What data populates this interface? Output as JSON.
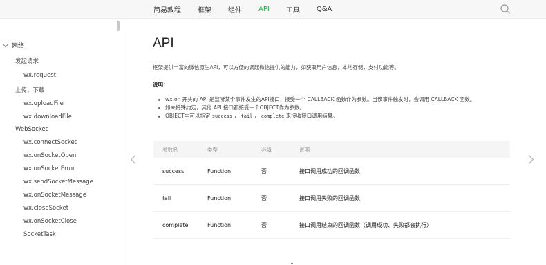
{
  "nav": {
    "items": [
      {
        "label": "简易教程",
        "active": false
      },
      {
        "label": "框架",
        "active": false
      },
      {
        "label": "组件",
        "active": false
      },
      {
        "label": "API",
        "active": true
      },
      {
        "label": "工具",
        "active": false
      },
      {
        "label": "Q&A",
        "active": false
      }
    ],
    "accent_color": "#16b23b"
  },
  "sidebar": {
    "group": "网络",
    "sections": [
      {
        "title": "发起请求",
        "items": [
          "wx.request"
        ]
      },
      {
        "title": "上传、下载",
        "items": [
          "wx.uploadFile",
          "wx.downloadFile"
        ]
      },
      {
        "title": "WebSocket",
        "items": [
          "wx.connectSocket",
          "wx.onSocketOpen",
          "wx.onSocketError",
          "wx.sendSocketMessage",
          "wx.onSocketMessage",
          "wx.closeSocket",
          "wx.onSocketClose",
          "SocketTask"
        ]
      }
    ]
  },
  "content": {
    "title": "API",
    "intro": "框架提供丰富的微信原生API，可以方便的调起微信提供的能力，如获取用户信息，本地存储，支付功能等。",
    "note_title": "说明：",
    "bullets": {
      "b1": "wx.on 开头的 API 是监听某个事件发生的API接口，接受一个 CALLBACK 函数作为参数。当该事件触发时，会调用 CALLBACK 函数。",
      "b2": "如未特殊约定，其他 API 接口都接受一个OBJECT作为参数。",
      "b3_pre": "OBJECT中可以指定",
      "code1": "success",
      "sep1": "，",
      "code2": "fail",
      "sep2": "，",
      "code3": "complete",
      "b3_post": "来接收接口调用结果。"
    },
    "table": {
      "headers": [
        "参数名",
        "类型",
        "必填",
        "说明"
      ],
      "rows": [
        [
          "success",
          "Function",
          "否",
          "接口调用成功的回调函数"
        ],
        [
          "fail",
          "Function",
          "否",
          "接口调用失败的回调函数"
        ],
        [
          "complete",
          "Function",
          "否",
          "接口调用结束的回调函数（调用成功、失败都会执行）"
        ]
      ]
    }
  }
}
